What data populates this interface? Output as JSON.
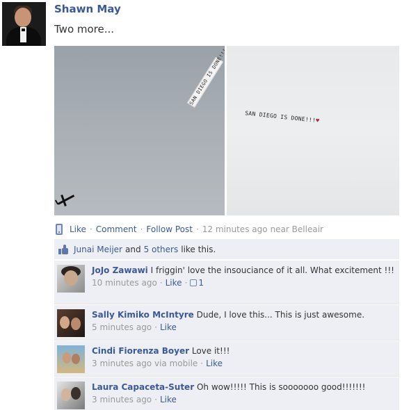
{
  "post": {
    "author": "Shawn May",
    "message": "Two more...",
    "photos": [
      {
        "banner_text": "SAN DIEGO IS DONE!!!",
        "banner_heart": "♥"
      },
      {
        "banner_text": "SAN DIEGO IS DONE!!!",
        "banner_heart": "♥"
      }
    ],
    "actions": {
      "like": "Like",
      "comment": "Comment",
      "follow": "Follow Post",
      "time": "12 minutes ago",
      "location": "near Belleair",
      "separator": "·"
    }
  },
  "likes": {
    "name": "Junai Meijer",
    "and": "and",
    "others": "5 others",
    "suffix": "like this."
  },
  "comments": [
    {
      "name": "JoJo Zawawi",
      "text": "I friggin' love the insouciance of it all. What excitement !!!",
      "time": "10 minutes ago",
      "like": "Like",
      "like_count": "1"
    },
    {
      "name": "Sally Kimiko McIntyre",
      "text": "Dude, I love this... This is just awesome.",
      "time": "5 minutes ago",
      "like": "Like"
    },
    {
      "name": "Cindi Fiorenza Boyer",
      "text": "Love it!!!",
      "time": "3 minutes ago",
      "via": "via mobile",
      "like": "Like"
    },
    {
      "name": "Laura Capaceta-Suter",
      "text": "Oh wow!!!!! This is sooooooo good!!!!!!!",
      "time": "3 minutes ago",
      "like": "Like"
    }
  ],
  "colors": {
    "link": "#3b5998",
    "meta": "#999999",
    "feedback_bg": "#edeff4"
  },
  "icons": {
    "mobile": "mobile-phone-icon",
    "like_thumb": "thumbs-up-icon"
  }
}
